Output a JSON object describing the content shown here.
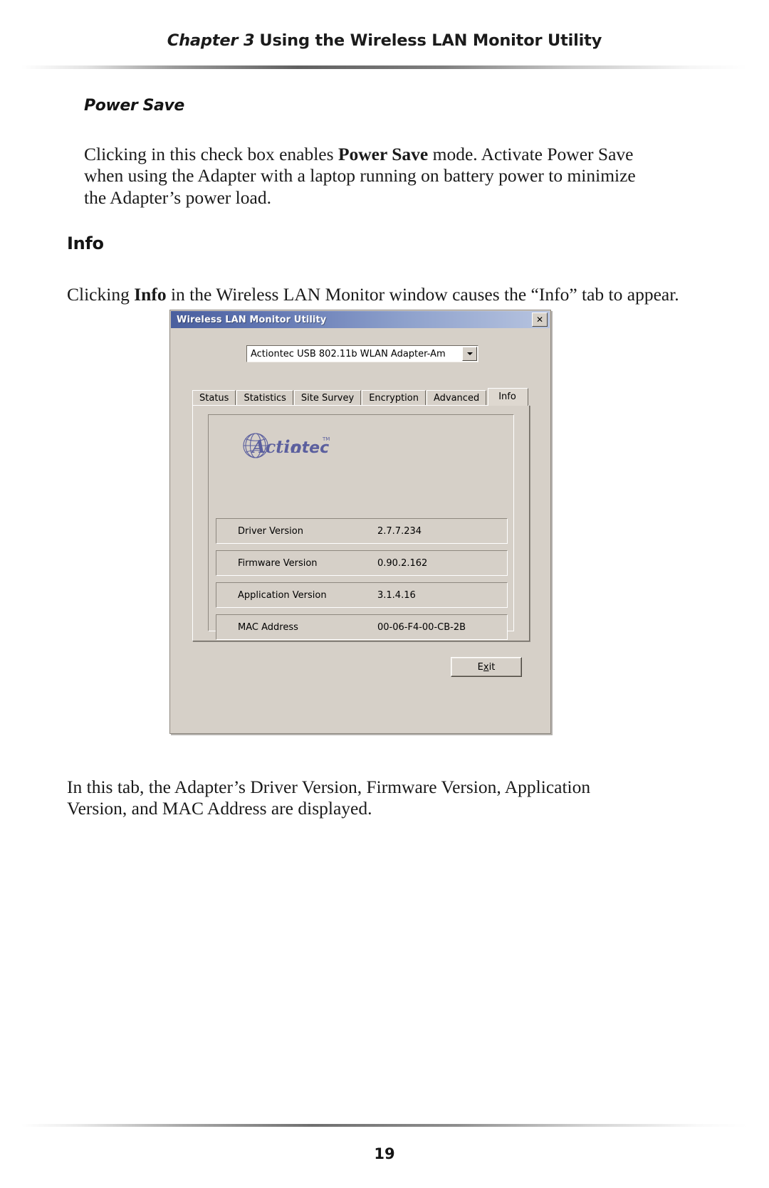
{
  "page": {
    "header": {
      "chapter_num": "Chapter 3",
      "chapter_title": "Using the Wireless LAN Monitor Utility"
    },
    "number": "19"
  },
  "sections": {
    "power_save": {
      "subhead": "Power Save",
      "body_part1": "Clicking in this check box enables ",
      "body_bold": "Power Save",
      "body_part2": " mode. Activate Power Save when using the Adapter with a laptop running on battery power to minimize the Adapter’s power load."
    },
    "info": {
      "heading": "Info",
      "intro_part1": "Clicking ",
      "intro_bold": "Info",
      "intro_part2": " in the Wireless LAN Monitor window causes the “Info” tab to appear.",
      "outro": "In this tab, the Adapter’s Driver Version, Firmware Version, Application Version, and MAC Address are displayed."
    }
  },
  "dialog": {
    "title": "Wireless LAN Monitor Utility",
    "close_label": "✕",
    "adapter_select": {
      "value": "Actiontec USB 802.11b WLAN Adapter-Am",
      "arrow_icon": "chevron-down-icon"
    },
    "tabs": [
      {
        "label": "Status",
        "active": false
      },
      {
        "label": "Statistics",
        "active": false
      },
      {
        "label": "Site Survey",
        "active": false
      },
      {
        "label": "Encryption",
        "active": false
      },
      {
        "label": "Advanced",
        "active": false
      },
      {
        "label": "Info",
        "active": true
      }
    ],
    "logo": {
      "name": "actiontec-logo",
      "text": "Actiontec",
      "trademark": "TM",
      "color": "#5b5f9e"
    },
    "info_rows": [
      {
        "label": "Driver Version",
        "value": "2.7.7.234"
      },
      {
        "label": "Firmware Version",
        "value": "0.90.2.162"
      },
      {
        "label": "Application Version",
        "value": "3.1.4.16"
      },
      {
        "label": "MAC Address",
        "value": "00-06-F4-00-CB-2B"
      }
    ],
    "exit_button": {
      "prefix": "E",
      "accel": "x",
      "suffix": "it"
    }
  },
  "colors": {
    "titlebar_start": "#4a5f9e",
    "titlebar_end": "#b7c4e0",
    "dialog_face": "#d6d0c8",
    "logo_purple": "#5b5f9e"
  }
}
